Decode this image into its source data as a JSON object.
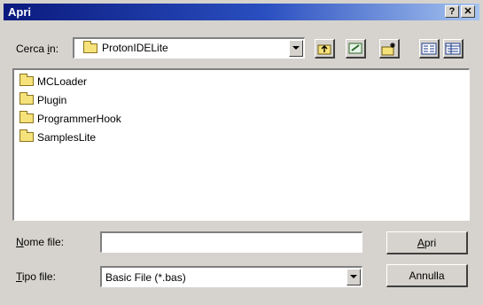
{
  "window": {
    "title": "Apri",
    "help_label": "?",
    "close_label": "✕"
  },
  "lookin": {
    "label_prefix": "Cerca ",
    "label_accel": "i",
    "label_suffix": "n:",
    "value": "ProtonIDELite"
  },
  "toolbar": {
    "icons": [
      "up-folder-icon",
      "desktop-icon",
      "new-folder-icon",
      "list-view-icon",
      "details-view-icon"
    ]
  },
  "files": [
    {
      "name": "MCLoader",
      "icon": "folder-icon"
    },
    {
      "name": "Plugin",
      "icon": "folder-icon"
    },
    {
      "name": "ProgrammerHook",
      "icon": "folder-icon"
    },
    {
      "name": "SamplesLite",
      "icon": "folder-icon"
    }
  ],
  "filename": {
    "label_accel": "N",
    "label_rest": "ome file:",
    "value": ""
  },
  "filetype": {
    "label_accel": "T",
    "label_rest": "ipo file:",
    "value": "Basic File (*.bas)"
  },
  "buttons": {
    "open_accel": "A",
    "open_rest": "pri",
    "cancel": "Annulla"
  }
}
